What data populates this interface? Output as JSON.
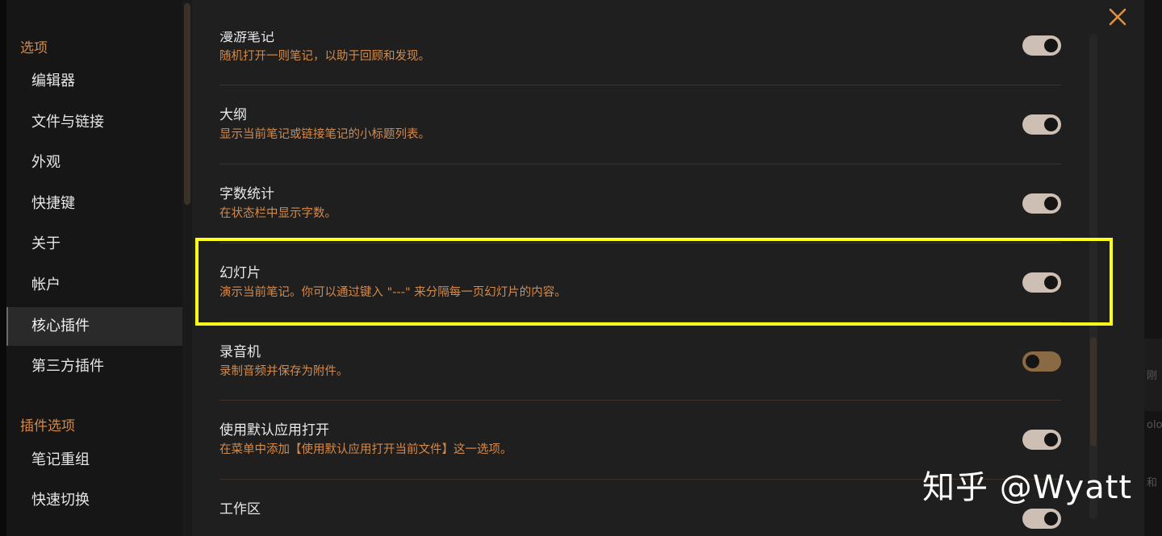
{
  "sidebar": {
    "headings": [
      "选项",
      "插件选项"
    ],
    "options_items": [
      {
        "label": "编辑器"
      },
      {
        "label": "文件与链接"
      },
      {
        "label": "外观"
      },
      {
        "label": "快捷键"
      },
      {
        "label": "关于"
      },
      {
        "label": "帐户"
      },
      {
        "label": "核心插件",
        "active": true
      },
      {
        "label": "第三方插件"
      }
    ],
    "plugin_items": [
      {
        "label": "笔记重组"
      },
      {
        "label": "快速切换"
      }
    ]
  },
  "plugins": [
    {
      "name": "漫游笔记",
      "description": "随机打开一则笔记，以助于回顾和发现。",
      "enabled": true
    },
    {
      "name": "大纲",
      "description": "显示当前笔记或链接笔记的小标题列表。",
      "enabled": true
    },
    {
      "name": "字数统计",
      "description": "在状态栏中显示字数。",
      "enabled": true
    },
    {
      "name": "幻灯片",
      "description": "演示当前笔记。你可以通过键入 \"---\" 来分隔每一页幻灯片的内容。",
      "enabled": true,
      "highlighted": true
    },
    {
      "name": "录音机",
      "description": "录制音频并保存为附件。",
      "enabled": false
    },
    {
      "name": "使用默认应用打开",
      "description": "在菜单中添加【使用默认应用打开当前文件】这一选项。",
      "enabled": true
    },
    {
      "name": "工作区",
      "description": "",
      "enabled": true
    }
  ],
  "close_icon": "close-icon",
  "highlight_color": "#ffff1a",
  "accent_color": "#d48a4a",
  "watermark": "知乎 @Wyatt",
  "background_fragments": [
    "刚",
    "olo",
    "和"
  ]
}
